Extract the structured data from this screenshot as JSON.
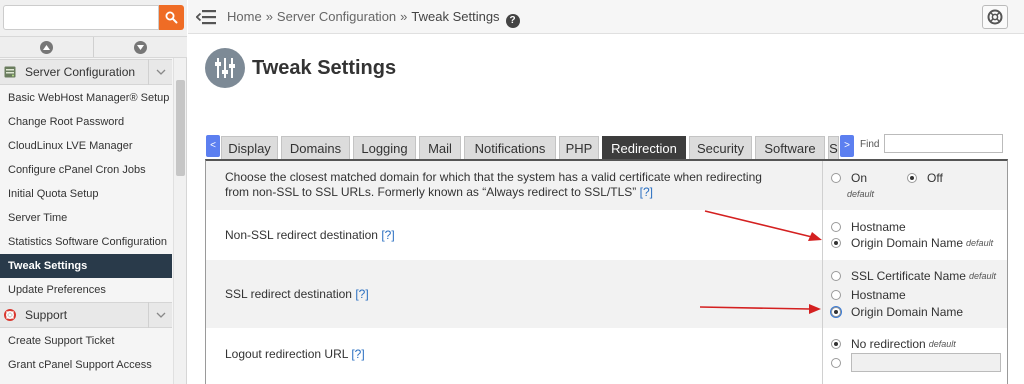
{
  "sidebar": {
    "search": {
      "value": "",
      "placeholder": ""
    },
    "groups": [
      {
        "label": "Server Configuration"
      },
      {
        "label": "Support"
      }
    ],
    "server_config_items": [
      "Basic WebHost Manager® Setup",
      "Change Root Password",
      "CloudLinux LVE Manager",
      "Configure cPanel Cron Jobs",
      "Initial Quota Setup",
      "Server Time",
      "Statistics Software Configuration",
      "Tweak Settings",
      "Update Preferences"
    ],
    "active_item": "Tweak Settings",
    "support_items": [
      "Create Support Ticket",
      "Grant cPanel Support Access"
    ]
  },
  "breadcrumb": {
    "home": "Home",
    "section": "Server Configuration",
    "current": "Tweak Settings",
    "separator": "»"
  },
  "page": {
    "title": "Tweak Settings"
  },
  "tabs": {
    "items": [
      "Display",
      "Domains",
      "Logging",
      "Mail",
      "Notifications",
      "PHP",
      "Redirection",
      "Security",
      "Software",
      "S"
    ],
    "active": "Redirection",
    "prev_label": "<",
    "next_label": ">"
  },
  "find": {
    "label": "Find",
    "value": ""
  },
  "settings": {
    "help_label": "[?]",
    "default_label": "default",
    "rows": [
      {
        "desc_line1": "Choose the closest matched domain for which that the system has a valid certificate when redirecting",
        "desc_line2": "from non-SSL to SSL URLs. Formerly known as “Always redirect to SSL/TLS”",
        "options": [
          {
            "label": "On",
            "checked": false,
            "default": true
          },
          {
            "label": "Off",
            "checked": true,
            "default": false
          }
        ]
      },
      {
        "desc": "Non-SSL redirect destination",
        "options": [
          {
            "label": "Hostname",
            "checked": false,
            "default": false
          },
          {
            "label": "Origin Domain Name",
            "checked": true,
            "default": true
          }
        ]
      },
      {
        "desc": "SSL redirect destination",
        "options": [
          {
            "label": "SSL Certificate Name",
            "checked": false,
            "default": true
          },
          {
            "label": "Hostname",
            "checked": false,
            "default": false
          },
          {
            "label": "Origin Domain Name",
            "checked": true,
            "default": false
          }
        ]
      },
      {
        "desc": "Logout redirection URL",
        "options": [
          {
            "label": "No redirection",
            "checked": true,
            "default": true
          },
          {
            "label": "",
            "checked": false,
            "default": false,
            "input_value": ""
          }
        ]
      }
    ]
  },
  "colors": {
    "search_button": "#ef6c25",
    "sidebar_active": "#293a4a",
    "tab_active": "#3d3d3d",
    "tab_scroll": "#5c7ff0",
    "link": "#2a6fc1",
    "annotation_arrow": "#d42020"
  },
  "icons": {
    "search": "search-icon",
    "hamburger": "menu-collapse-icon",
    "help": "help-icon",
    "support": "lifebuoy-icon",
    "page": "sliders-icon",
    "server_config": "server-config-icon",
    "support_group": "lifebuoy-icon"
  }
}
